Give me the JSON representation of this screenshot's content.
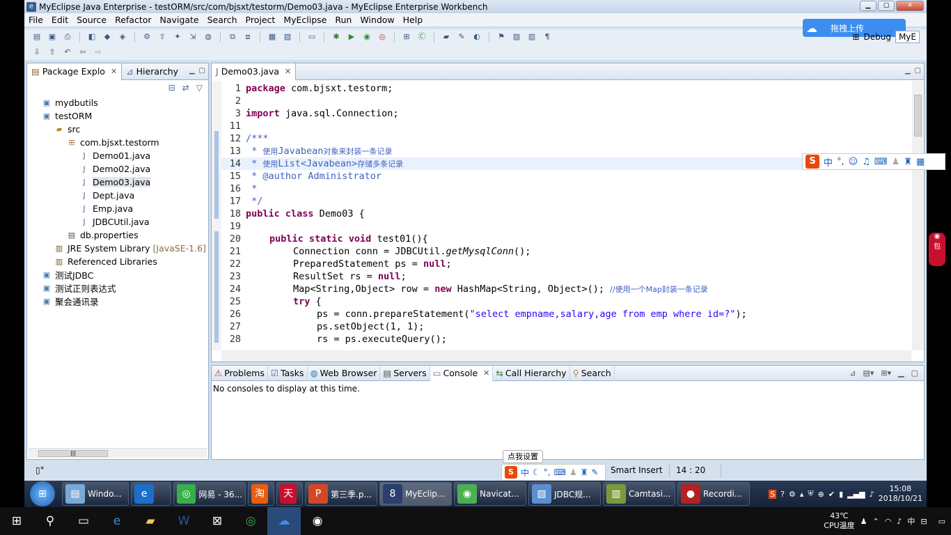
{
  "window": {
    "title": "MyEclipse Java Enterprise - testORM/src/com/bjsxt/testorm/Demo03.java - MyEclipse Enterprise Workbench"
  },
  "menu": [
    "File",
    "Edit",
    "Source",
    "Refactor",
    "Navigate",
    "Search",
    "Project",
    "MyEclipse",
    "Run",
    "Window",
    "Help"
  ],
  "cloud_upload": {
    "label": "拖拽上传"
  },
  "perspectives": {
    "debug": "Debug",
    "myeclipse": "MyE"
  },
  "package_explorer": {
    "tabs": [
      {
        "label": "Package Explo"
      },
      {
        "label": "Hierarchy"
      }
    ],
    "tree": [
      {
        "label": "mydbutils",
        "icon": "project-icon"
      },
      {
        "label": "testORM",
        "icon": "project-icon"
      },
      {
        "label": "src",
        "icon": "source-folder-icon"
      },
      {
        "label": "com.bjsxt.testorm",
        "icon": "package-icon"
      },
      {
        "label": "Demo01.java",
        "icon": "java-file-icon"
      },
      {
        "label": "Demo02.java",
        "icon": "java-file-icon"
      },
      {
        "label": "Demo03.java",
        "icon": "java-file-icon"
      },
      {
        "label": "Dept.java",
        "icon": "java-file-icon"
      },
      {
        "label": "Emp.java",
        "icon": "java-file-icon"
      },
      {
        "label": "JDBCUtil.java",
        "icon": "java-file-icon"
      },
      {
        "label": "db.properties",
        "icon": "properties-file-icon"
      },
      {
        "label": "JRE System Library",
        "extra": "[JavaSE-1.6]",
        "icon": "library-icon"
      },
      {
        "label": "Referenced Libraries",
        "icon": "library-icon"
      },
      {
        "label": "测试JDBC",
        "icon": "project-icon"
      },
      {
        "label": "测试正则表达式",
        "icon": "project-icon"
      },
      {
        "label": "聚会通讯录",
        "icon": "project-icon"
      }
    ]
  },
  "editor": {
    "tab": "Demo03.java",
    "lines": [
      {
        "n": "1"
      },
      {
        "n": "2"
      },
      {
        "n": "3"
      },
      {
        "n": "11"
      },
      {
        "n": "12"
      },
      {
        "n": "13"
      },
      {
        "n": "14"
      },
      {
        "n": "15"
      },
      {
        "n": "16"
      },
      {
        "n": "17"
      },
      {
        "n": "18"
      },
      {
        "n": "19"
      },
      {
        "n": "20"
      },
      {
        "n": "21"
      },
      {
        "n": "22"
      },
      {
        "n": "23"
      },
      {
        "n": "24"
      },
      {
        "n": "25"
      },
      {
        "n": "26"
      },
      {
        "n": "27"
      },
      {
        "n": "28"
      }
    ],
    "code": {
      "l1_kw": "package",
      "l1_rest": " com.bjsxt.testorm;",
      "l3_kw": "import",
      "l3_rest": " java.sql.Connection;",
      "l12": "/***",
      "l13_a": " * ",
      "l13_b": "使用",
      "l13_c": "Javabean",
      "l13_d": "对象来封装一条记录",
      "l14_a": " * ",
      "l14_b": "使用",
      "l14_c": "List<Javabean>",
      "l14_d": "存储多条记录",
      "l15": " * @author Administrator",
      "l16": " *",
      "l17": " */",
      "l18_kw": "public class",
      "l18_rest": " Demo03 {",
      "l20_kw": "public static void",
      "l20_rest": " test01(){",
      "l21_a": "Connection conn = JDBCUtil.",
      "l21_b": "getMysqlConn",
      "l21_c": "();",
      "l22_a": "PreparedStatement ps = ",
      "l22_kw": "null",
      "l22_c": ";",
      "l23_a": "ResultSet rs = ",
      "l23_kw": "null",
      "l23_c": ";",
      "l24_a": "Map<String,Object> row = ",
      "l24_kw": "new",
      "l24_b": " HashMap<String, Object>(); ",
      "l24_cm": "//使用一个Map封装一条记录",
      "l25_kw": "try",
      "l25_rest": " {",
      "l26_a": "ps = conn.prepareStatement(",
      "l26_str": "\"select empname,salary,age from emp where id=?\"",
      "l26_c": ");",
      "l27": "ps.setObject(1, 1);",
      "l28": "rs = ps.executeQuery();"
    }
  },
  "console_panel": {
    "tabs": [
      "Problems",
      "Tasks",
      "Web Browser",
      "Servers",
      "Console",
      "Call Hierarchy",
      "Search"
    ],
    "message": "No consoles to display at this time."
  },
  "status": {
    "insert_mode": "Smart Insert",
    "position": "14 : 20"
  },
  "ime": {
    "lang": "中",
    "tooltip": "点我设置"
  },
  "taskbar_win7": {
    "items": [
      {
        "label": "Windo...",
        "color": "#7aa9d8"
      },
      {
        "label": "",
        "color": "#1b6fc8"
      },
      {
        "label": "网易 - 36...",
        "color": "#38b04a"
      },
      {
        "label": "",
        "color": "#e85d10"
      },
      {
        "label": "",
        "color": "#c8102e"
      },
      {
        "label": "第三季.p...",
        "color": "#d24726"
      },
      {
        "label": "MyEclip...",
        "color": "#2a3f6e"
      },
      {
        "label": "Navicat...",
        "color": "#4caf50"
      },
      {
        "label": "JDBC规...",
        "color": "#5a8fd0"
      },
      {
        "label": "Camtasi...",
        "color": "#7a9a3a"
      },
      {
        "label": "Recordi...",
        "color": "#b22222"
      }
    ],
    "time": "15:08",
    "date": "2018/10/21"
  },
  "taskbar_win10": {
    "temp": "43℃",
    "temp_label": "CPU温度",
    "tray_lang": "中",
    "time": "",
    "date": ""
  }
}
